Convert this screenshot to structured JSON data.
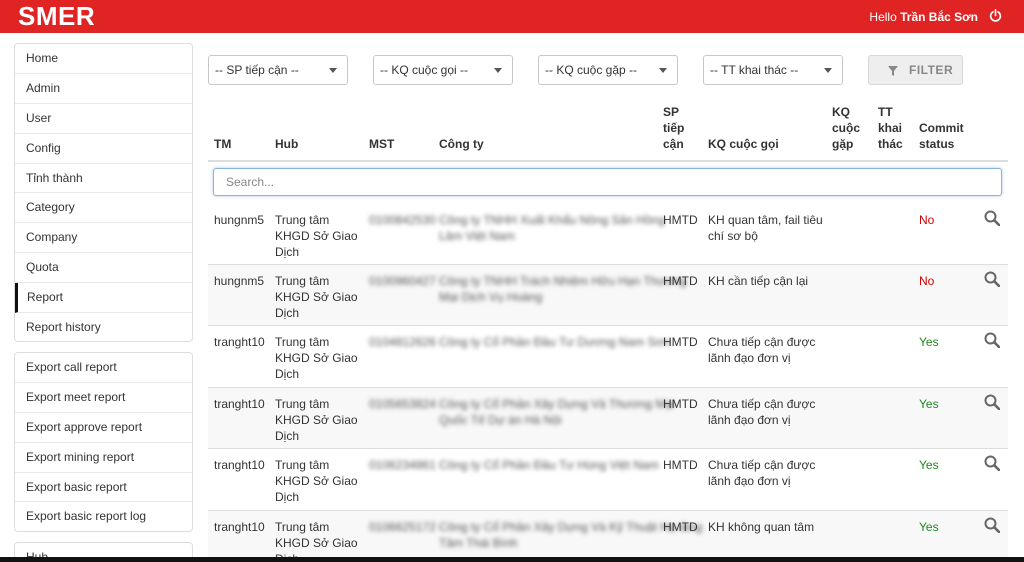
{
  "header": {
    "brand": "SMER",
    "greeting": "Hello",
    "user_name": "Trần Bắc Sơn",
    "accent": "#e02424"
  },
  "sidebar": {
    "group1": [
      "Home",
      "Admin",
      "User",
      "Config",
      "Tỉnh thành",
      "Category",
      "Company",
      "Quota",
      "Report",
      "Report history"
    ],
    "active": "Report",
    "group2": [
      "Export call report",
      "Export meet report",
      "Export approve report",
      "Export mining report",
      "Export basic report",
      "Export basic report log"
    ],
    "group3": [
      "Hub"
    ]
  },
  "filters": {
    "sp": "-- SP tiếp cận --",
    "kq_call": "-- KQ cuộc gọi --",
    "kq_meet": "-- KQ cuộc gặp --",
    "tt": "-- TT khai thác --",
    "button": "FILTER"
  },
  "table": {
    "headers": {
      "tm": "TM",
      "hub": "Hub",
      "mst": "MST",
      "company": "Công ty",
      "sp": [
        "SP",
        "tiếp",
        "cận"
      ],
      "kq_call": "KQ cuộc gọi",
      "kq_meet": [
        "KQ",
        "cuộc",
        "gặp"
      ],
      "tt": [
        "TT",
        "khai",
        "thác"
      ],
      "commit": [
        "Commit",
        "status"
      ]
    },
    "search_placeholder": "Search...",
    "rows": [
      {
        "tm": "hungnm5",
        "hub": [
          "Trung tâm",
          "KHGD Sở Giao",
          "Dịch"
        ],
        "mst": "0100842530",
        "company": [
          "Công ty TNHH Xuất Khẩu Nông Sản Hồng",
          "Lâm Việt Nam"
        ],
        "sp": "HMTD",
        "kq_call": [
          "KH quan tâm, fail tiêu",
          "chí sơ bộ"
        ],
        "status": "No"
      },
      {
        "tm": "hungnm5",
        "hub": [
          "Trung tâm",
          "KHGD Sở Giao",
          "Dịch"
        ],
        "mst": "0100960427",
        "company": [
          "Công ty TNHH Trách Nhiệm Hữu Hạn Thương",
          "Mại Dịch Vụ Hoàng"
        ],
        "sp": "HMTD",
        "kq_call": [
          "KH cần tiếp cận lại"
        ],
        "status": "No"
      },
      {
        "tm": "tranght10",
        "hub": [
          "Trung tâm",
          "KHGD Sở Giao",
          "Dịch"
        ],
        "mst": "0104812626",
        "company": [
          "Công ty Cổ Phần Đầu Tư Dương Nam Sơn"
        ],
        "sp": "HMTD",
        "kq_call": [
          "Chưa tiếp cận được",
          "lãnh đạo đơn vị"
        ],
        "status": "Yes"
      },
      {
        "tm": "tranght10",
        "hub": [
          "Trung tâm",
          "KHGD Sở Giao",
          "Dịch"
        ],
        "mst": "0105653824",
        "company": [
          "Công ty Cổ Phần Xây Dựng Và Thương Mại",
          "Quốc Tế Dự án Hà Nội"
        ],
        "sp": "HMTD",
        "kq_call": [
          "Chưa tiếp cận được",
          "lãnh đạo đơn vị"
        ],
        "status": "Yes"
      },
      {
        "tm": "tranght10",
        "hub": [
          "Trung tâm",
          "KHGD Sở Giao",
          "Dịch"
        ],
        "mst": "0106234861",
        "company": [
          "Công ty Cổ Phần Đầu Tư Hùng Việt Nam"
        ],
        "sp": "HMTD",
        "kq_call": [
          "Chưa tiếp cận được",
          "lãnh đạo đơn vị"
        ],
        "status": "Yes"
      },
      {
        "tm": "tranght10",
        "hub": [
          "Trung tâm",
          "KHGD Sở Giao",
          "Dịch"
        ],
        "mst": "0106625172",
        "company": [
          "Công ty Cổ Phần Xây Dựng Và Kỹ Thuật Hạ tầng",
          "Tâm Thái Bình"
        ],
        "sp": "HMTD",
        "kq_call": [
          "KH không quan tâm"
        ],
        "status": "Yes"
      }
    ]
  },
  "colors": {
    "no": "#d00000",
    "yes": "#1c8a1c"
  }
}
